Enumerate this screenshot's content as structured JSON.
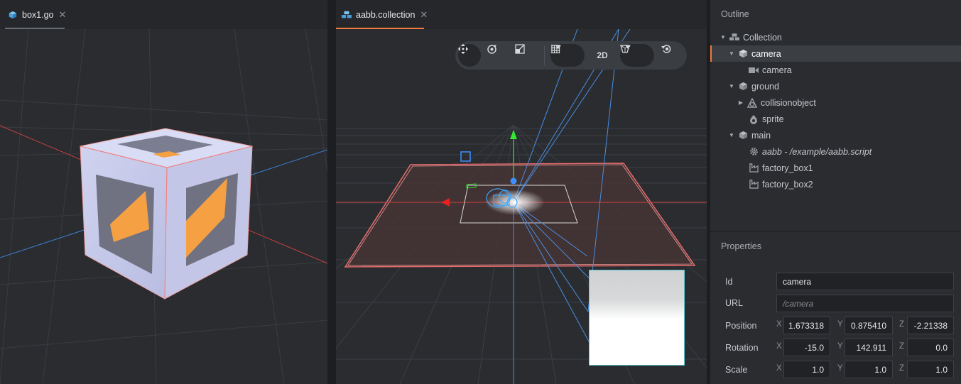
{
  "left_tab": {
    "title": "box1.go",
    "close": "✕"
  },
  "right_tab": {
    "title": "aabb.collection",
    "close": "✕"
  },
  "toolbar": {
    "mode_2d": "2D"
  },
  "outline": {
    "title": "Outline",
    "items": [
      {
        "label": "Collection"
      },
      {
        "label": "camera"
      },
      {
        "label": "camera"
      },
      {
        "label": "ground"
      },
      {
        "label": "collisionobject"
      },
      {
        "label": "sprite"
      },
      {
        "label": "main"
      },
      {
        "label": "aabb - /example/aabb.script"
      },
      {
        "label": "factory_box1"
      },
      {
        "label": "factory_box2"
      }
    ]
  },
  "properties": {
    "title": "Properties",
    "id": {
      "label": "Id",
      "value": "camera"
    },
    "url": {
      "label": "URL",
      "value": "/camera"
    },
    "position": {
      "label": "Position",
      "x": "1.673318",
      "y": "0.875410",
      "z": "-2.21338"
    },
    "rotation": {
      "label": "Rotation",
      "x": "-15.0",
      "y": "142.911",
      "z": "0.0"
    },
    "scale": {
      "label": "Scale",
      "x": "1.0",
      "y": "1.0",
      "z": "1.0"
    },
    "axes": {
      "x": "X",
      "y": "Y",
      "z": "Z"
    }
  },
  "colors": {
    "accent_orange": "#f07b3f",
    "selection_bg": "#3b3e43",
    "preview_border": "#5ac8cf"
  }
}
